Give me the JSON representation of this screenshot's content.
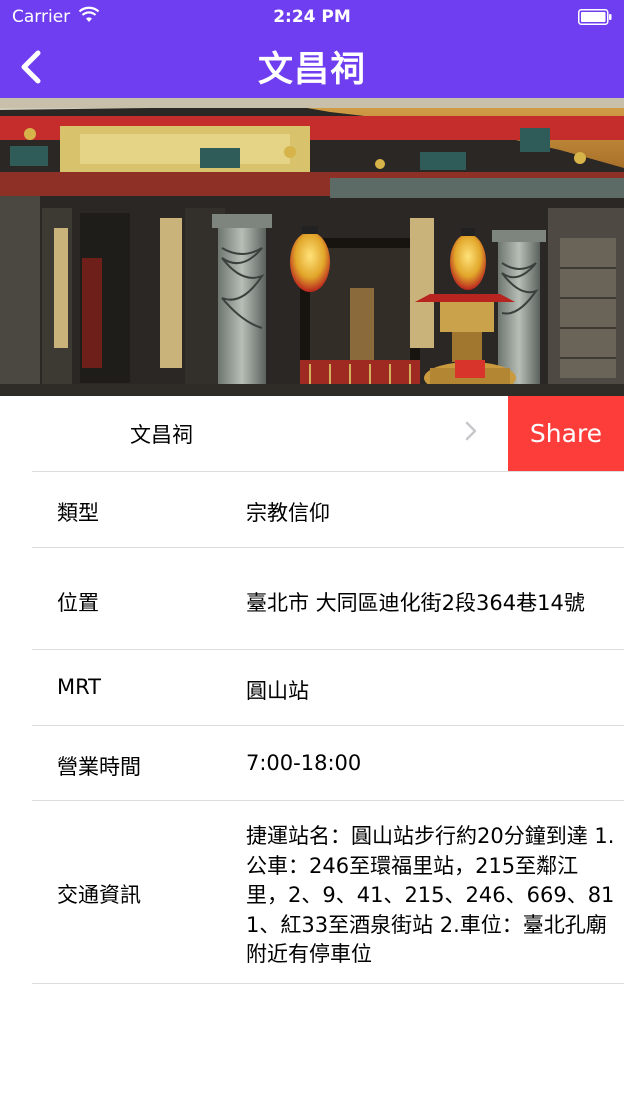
{
  "status_bar": {
    "carrier": "Carrier",
    "time": "2:24 PM"
  },
  "nav": {
    "title": "文昌祠",
    "back_icon": "chevron-left-icon"
  },
  "hero_image": {
    "alt": "文昌祠"
  },
  "header_row": {
    "name": "文昌祠",
    "share_label": "Share",
    "share_color": "#fc3d39"
  },
  "info": {
    "type_label": "類型",
    "type_value": "宗教信仰",
    "location_label": "位置",
    "location_value": "臺北市  大同區迪化街2段364巷14號",
    "mrt_label": "MRT",
    "mrt_value": "圓山站",
    "hours_label": "營業時間",
    "hours_value": "7:00-18:00",
    "transport_label": "交通資訊",
    "transport_value": "捷運站名：圓山站步行約20分鐘到達 1.公車：246至環福里站，215至鄰江里，2、9、41、215、246、669、811、紅33至酒泉街站 2.車位：臺北孔廟附近有停車位"
  },
  "colors": {
    "nav_background": "#6f3ef0",
    "share_background": "#fc3d39",
    "separator": "#dcdcdc"
  }
}
